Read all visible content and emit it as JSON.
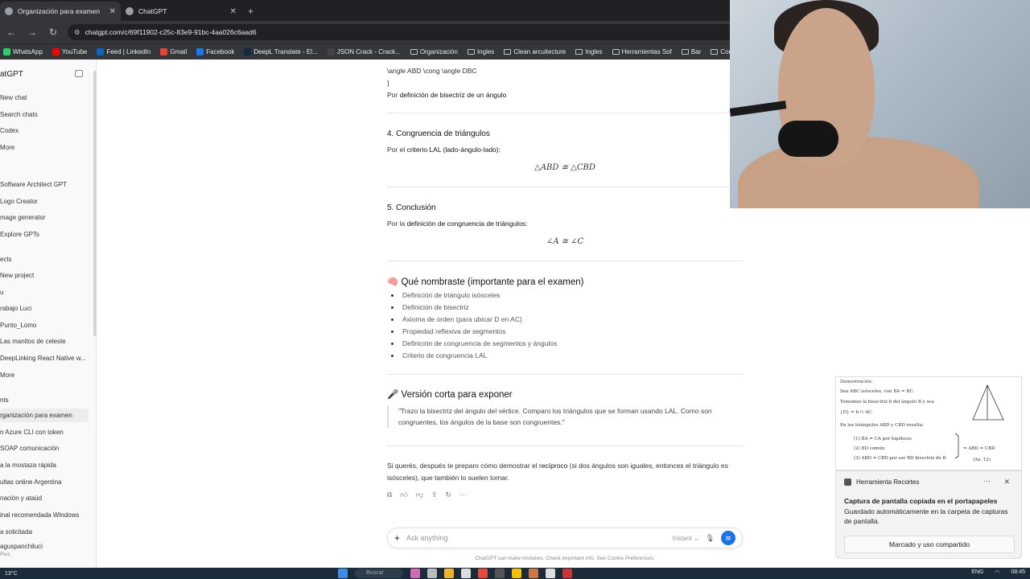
{
  "browser": {
    "tabs": [
      {
        "title": "Organización para examen",
        "active": true
      },
      {
        "title": "ChatGPT",
        "active": false
      }
    ],
    "new_tab": "+",
    "url": "chatgpt.com/c/69f11902-c25c-83e9-91bc-4aa026c6aad6",
    "bookmarks": [
      {
        "label": "WhatsApp",
        "icon": "whatsapp-icon",
        "color": "#25d366"
      },
      {
        "label": "YouTube",
        "icon": "youtube-icon",
        "color": "#ff0000"
      },
      {
        "label": "Feed | LinkedIn",
        "icon": "linkedin-icon",
        "color": "#0a66c2"
      },
      {
        "label": "Gmail",
        "icon": "gmail-icon",
        "color": "#ea4335"
      },
      {
        "label": "Facebook",
        "icon": "facebook-icon",
        "color": "#1877f2"
      },
      {
        "label": "DeepL Translate - El...",
        "icon": "deepl-icon",
        "color": "#0f2b46"
      },
      {
        "label": "JSON Crack - Crack...",
        "icon": "jsoncrack-icon",
        "color": "#444444"
      },
      {
        "label": "Organización",
        "icon": "folder-icon"
      },
      {
        "label": "Ingles",
        "icon": "folder-icon"
      },
      {
        "label": "Clean arcuitecture",
        "icon": "folder-icon"
      },
      {
        "label": "Ingles",
        "icon": "folder-icon"
      },
      {
        "label": "Herramientas Sof",
        "icon": "folder-icon"
      },
      {
        "label": "Bar",
        "icon": "folder-icon"
      },
      {
        "label": "Conc",
        "icon": "folder-icon"
      }
    ]
  },
  "sidebar": {
    "title": "atGPT",
    "items": [
      "New chat",
      "Search chats",
      "Codex",
      "More"
    ],
    "gpts": [
      "Software Architect GPT",
      "Logo Creator",
      "mage generator",
      "Explore GPTs"
    ],
    "projects_label": "ects",
    "projects": [
      "New project",
      "u",
      "rabajo Luci",
      "Punto_Lomo",
      "Las manitos de celeste",
      "DeepLinking React Native w...",
      "More"
    ],
    "chats_label": "nts",
    "chats": [
      "rganización para examen",
      "n Azure CLI con token",
      "SOAP comunicación",
      "a la mostaza rápida",
      "ultas online Argentina",
      "nación y ataúd",
      "inal recomendada Windows",
      "a solicitada"
    ],
    "user_name": "aguspanchiluci",
    "user_plan": "Plus"
  },
  "conversation": {
    "line_top": "\\angle ABD \\cong \\angle DBC",
    "bracket": "]",
    "line_def_prefix": "Por ",
    "line_def_bold": "definición de bisectriz de un ángulo",
    "s4_title": "4. Congruencia de triángulos",
    "s4_prefix": "Por el ",
    "s4_bold": "criterio LAL (lado-ángulo-lado):",
    "s4_math": "△ABD ≅ △CBD",
    "s5_title": "5. Conclusión",
    "s5_prefix": "Por la ",
    "s5_bold": "definición de congruencia de triángulos:",
    "s5_math": "∠A ≅ ∠C",
    "named_emoji": "🧠",
    "named_title": "Qué nombraste (importante para el examen)",
    "named_list": [
      "Definición de triángulo isósceles",
      "Definición de bisectriz",
      "Axioma de orden (para ubicar D en AC)",
      "Propiedad reflexiva de segmentos",
      "Definición de congruencia de segmentos y ángulos",
      "Criterio de congruencia LAL"
    ],
    "short_emoji": "🎤",
    "short_title": "Versión corta para exponer",
    "short_quote": "\"Trazo la bisectriz del ángulo del vértice. Comparo los triángulos que se forman usando LAL. Como son congruentes, los ángulos de la base son congruentes.\"",
    "closing_prefix": "Si querés, después te preparo cómo demostrar el ",
    "closing_bold": "recíproco",
    "closing_suffix": " (si dos ángulos son iguales, entonces el triángulo es isósceles), que también lo suelen tomar."
  },
  "composer": {
    "placeholder": "Ask anything",
    "mode": "Instant ⌄",
    "disclaimer": "ChatGPT can make mistakes. Check important info. See Cookie Preferences."
  },
  "snip_preview": {
    "lines": [
      "Demostración:",
      "Sea ABC isósceles, con BA = BC.",
      "Tomemos la bisectriz b del ángulo B y sea",
      "{D} = b ∩ AC.",
      "En los triángulos ABD y CBD resulta:",
      "(1) BA = CA por hipótesis",
      "(2) BD común",
      "(3) ABD = CBD por ser BD bisectriz de B",
      "⇒ ABD = CBD",
      "(Ax. 12)"
    ]
  },
  "notification": {
    "app": "Herramienta Recortes",
    "more": "···",
    "close": "✕",
    "title": "Captura de pantalla copiada en el portapapeles",
    "body": "Guardado automáticamente en la carpeta de capturas de pantalla.",
    "action": "Marcado y uso compartido"
  },
  "taskbar": {
    "weather": "13°C",
    "search": "Buscar",
    "language": "ENG",
    "time": "08:45"
  }
}
